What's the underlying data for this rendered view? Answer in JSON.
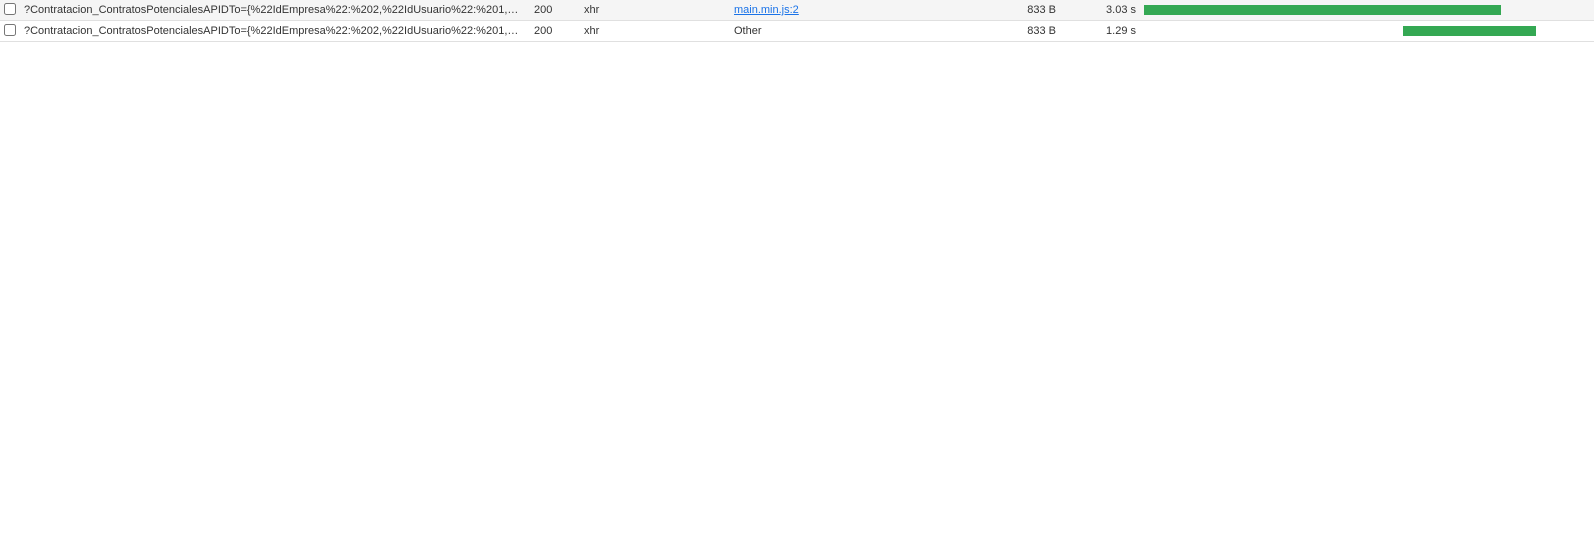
{
  "rows": [
    {
      "id": "row1",
      "checked": false,
      "name": "?Contratacion_ContratosPotencialesAPIDTo={%22IdEmpresa%22:%202,%22IdUsuario%22:%201,%22...",
      "status": "200",
      "type": "xhr",
      "initiator": "main.min.js:2",
      "initiator_is_link": true,
      "size": "833 B",
      "time": "3.03 s",
      "waterfall_left_pct": 0,
      "waterfall_width_pct": 80
    },
    {
      "id": "row2",
      "checked": false,
      "name": "?Contratacion_ContratosPotencialesAPIDTo={%22IdEmpresa%22:%202,%22IdUsuario%22:%201,%22...",
      "status": "200",
      "type": "xhr",
      "initiator": "Other",
      "initiator_is_link": false,
      "size": "833 B",
      "time": "1.29 s",
      "waterfall_left_pct": 58,
      "waterfall_width_pct": 30
    }
  ],
  "colors": {
    "bar": "#34a853",
    "link": "#1a73e8"
  }
}
